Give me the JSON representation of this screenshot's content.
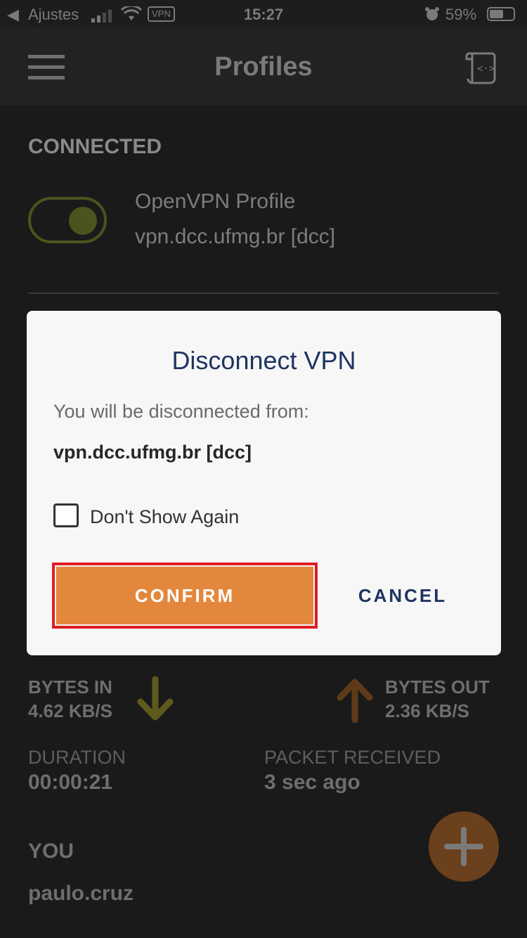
{
  "status_bar": {
    "back_label": "Ajustes",
    "vpn_badge": "VPN",
    "time": "15:27",
    "battery": "59%",
    "battery_level": 0.59
  },
  "header": {
    "title": "Profiles",
    "menu_icon": "hamburger-menu-icon",
    "import_icon": "import-profile-icon"
  },
  "connection": {
    "section_label": "CONNECTED",
    "toggle_on": true,
    "profile_name": "OpenVPN Profile",
    "server": "vpn.dcc.ufmg.br [dcc]"
  },
  "stats": {
    "bytes_in_label": "BYTES IN",
    "bytes_in_value": "4.62 KB/S",
    "bytes_out_label": "BYTES OUT",
    "bytes_out_value": "2.36 KB/S",
    "duration_label": "DURATION",
    "duration_value": "00:00:21",
    "packet_label": "PACKET RECEIVED",
    "packet_value": "3 sec ago",
    "you_label": "YOU",
    "you_value": "paulo.cruz"
  },
  "dialog": {
    "title": "Disconnect VPN",
    "message": "You will be disconnected from:",
    "server": "vpn.dcc.ufmg.br [dcc]",
    "checkbox_label": "Don't Show Again",
    "checkbox_checked": false,
    "confirm_label": "CONFIRM",
    "cancel_label": "CANCEL"
  },
  "colors": {
    "accent_orange": "#e3873c",
    "dialog_title": "#1e3461",
    "highlight_border": "#e01d24",
    "toggle_green": "#4d531d"
  }
}
